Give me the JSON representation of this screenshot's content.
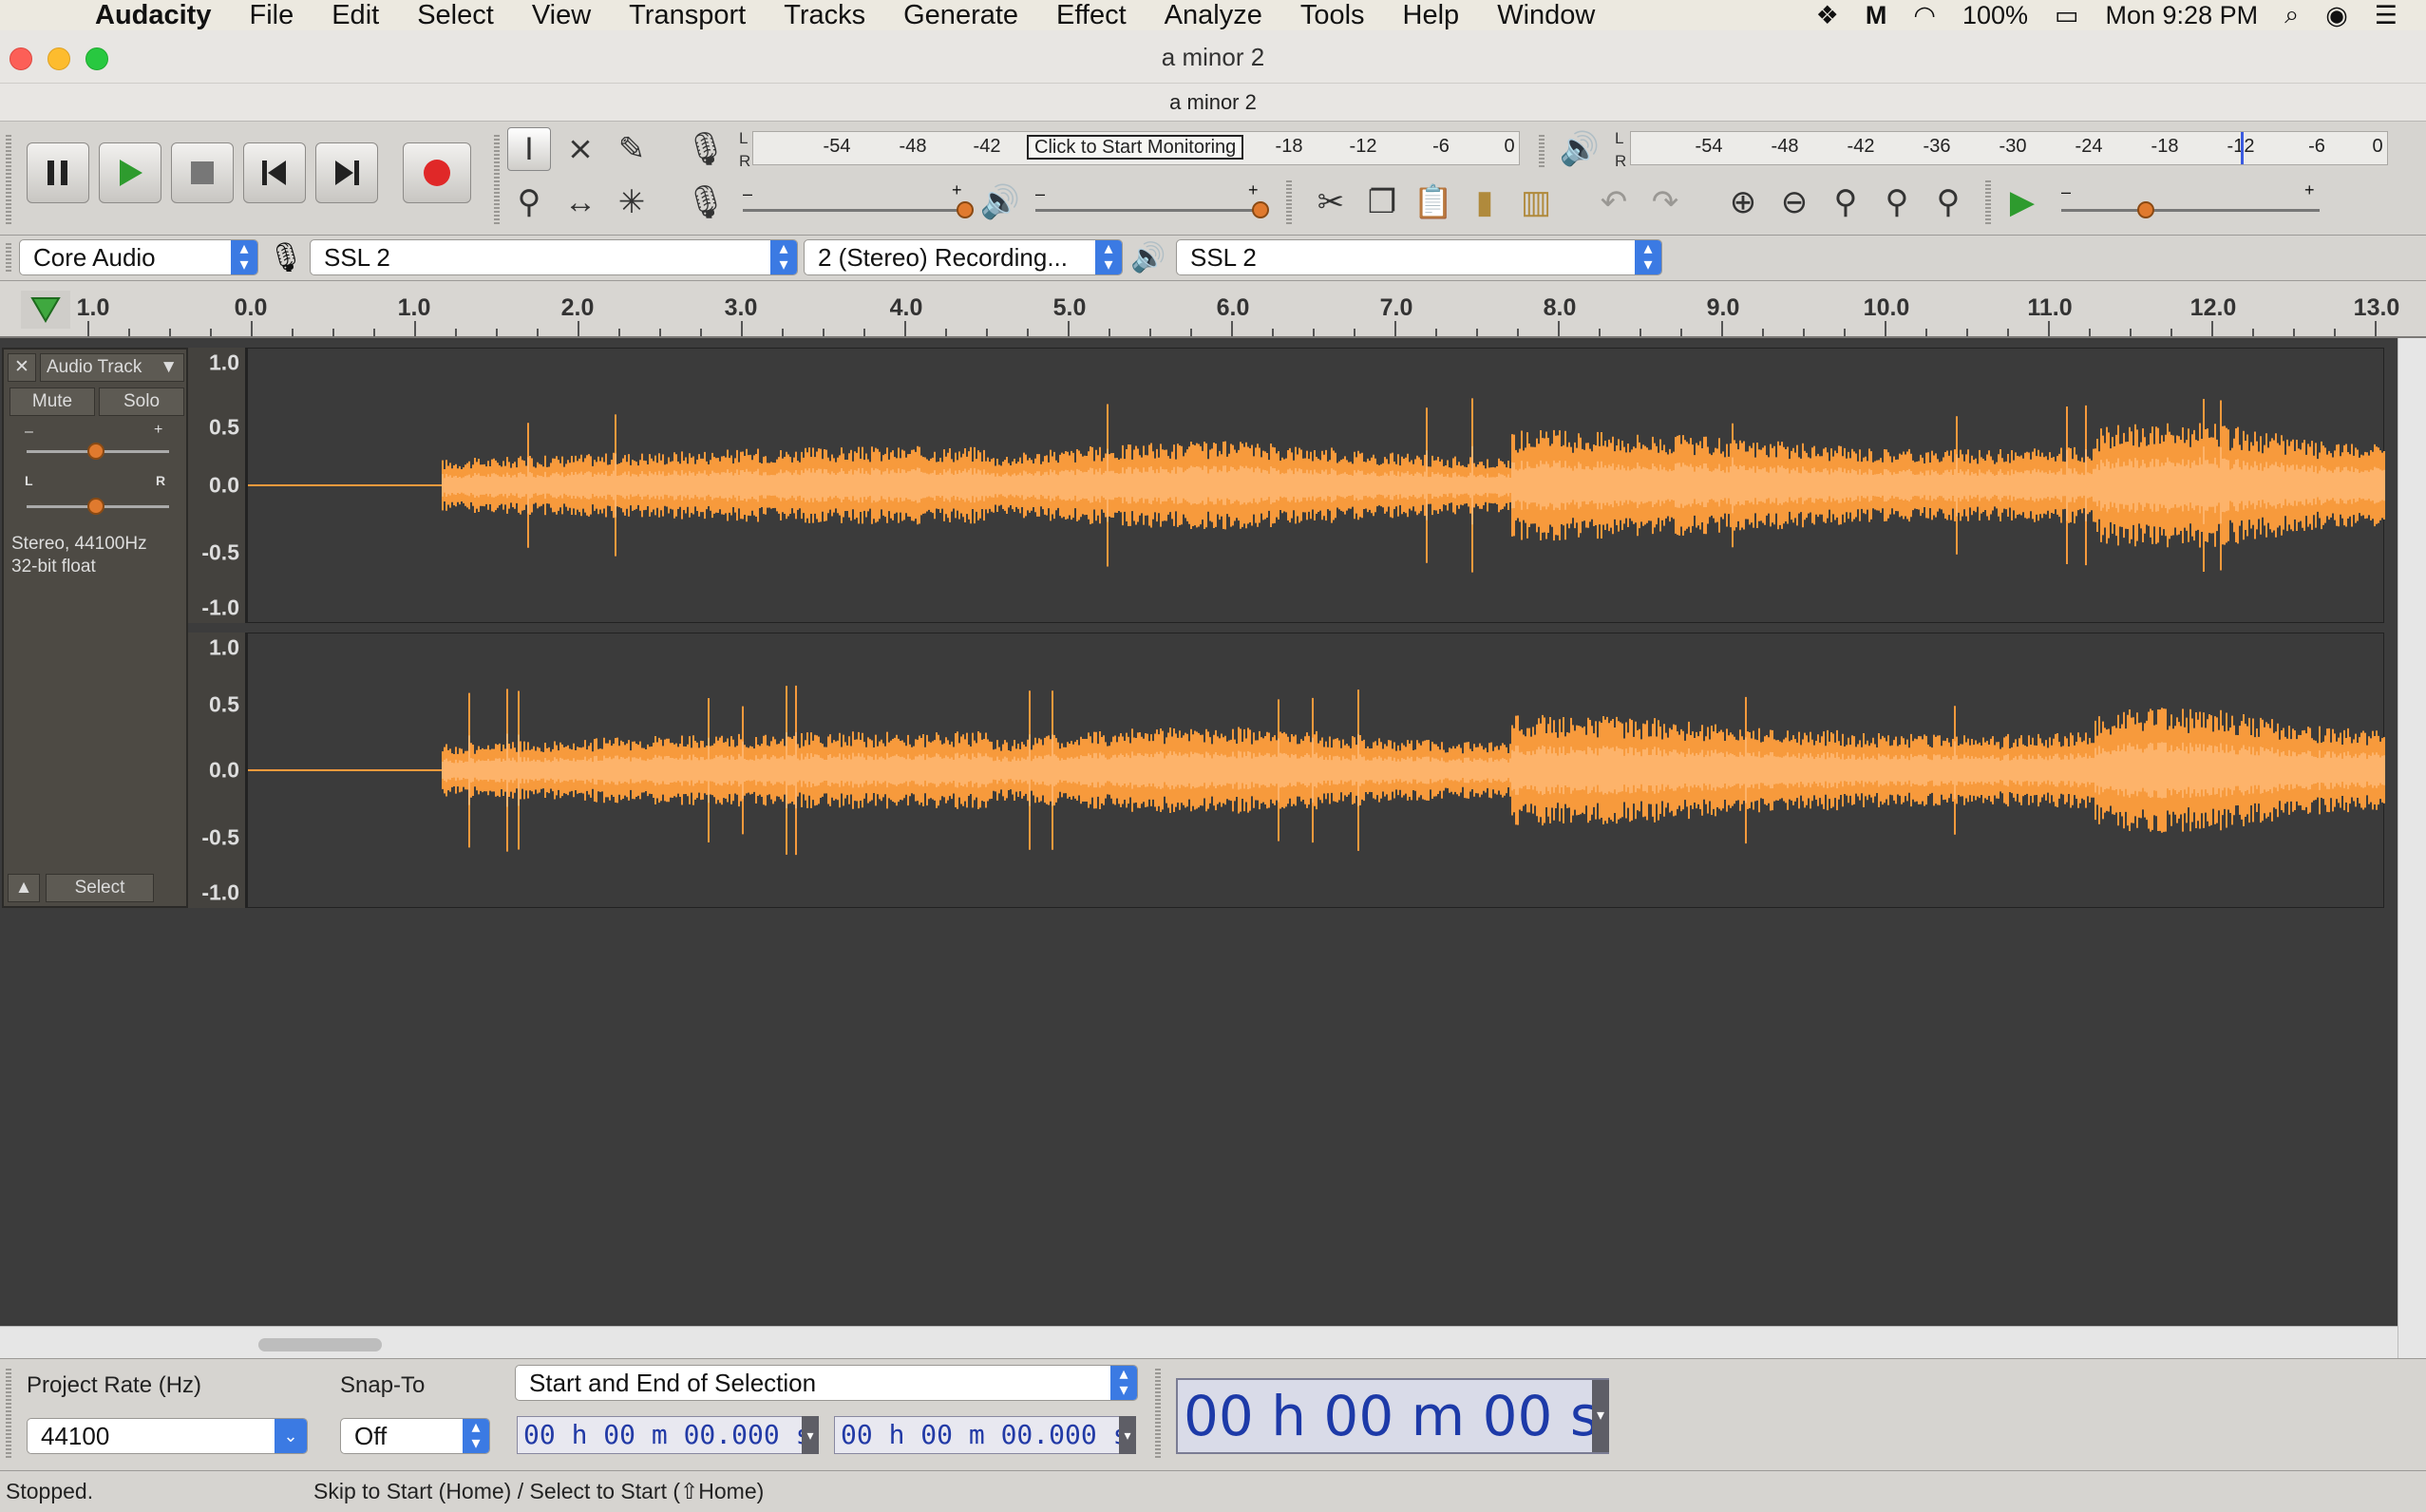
{
  "menubar": {
    "app_name": "Audacity",
    "items": [
      "File",
      "Edit",
      "Select",
      "View",
      "Transport",
      "Tracks",
      "Generate",
      "Effect",
      "Analyze",
      "Tools",
      "Help",
      "Window"
    ],
    "battery": "100%",
    "clock": "Mon 9:28 PM"
  },
  "window": {
    "title": "a minor 2",
    "subtitle": "a minor 2"
  },
  "meters": {
    "record_ticks": [
      "-54",
      "-48",
      "-42",
      "-18",
      "-12",
      "-6",
      "0"
    ],
    "monitor_prompt": "Click to Start Monitoring",
    "playback_ticks": [
      "-54",
      "-48",
      "-42",
      "-36",
      "-30",
      "-24",
      "-18",
      "-12",
      "-6",
      "0"
    ],
    "channel_left": "L",
    "channel_right": "R"
  },
  "devices": {
    "host": "Core Audio",
    "recording_device": "SSL 2",
    "recording_channels": "2 (Stereo) Recording...",
    "playback_device": "SSL 2"
  },
  "ruler": {
    "labels": [
      "1.0",
      "0.0",
      "1.0",
      "2.0",
      "3.0",
      "4.0",
      "5.0",
      "6.0",
      "7.0",
      "8.0",
      "9.0",
      "10.0",
      "11.0",
      "12.0",
      "13.0"
    ]
  },
  "track": {
    "name": "Audio Track",
    "mute_label": "Mute",
    "solo_label": "Solo",
    "gain_minus": "–",
    "gain_plus": "+",
    "pan_left": "L",
    "pan_right": "R",
    "format_line1": "Stereo, 44100Hz",
    "format_line2": "32-bit float",
    "select_label": "Select",
    "amplitude_labels": [
      "1.0",
      "0.5",
      "0.0",
      "-0.5",
      "-1.0"
    ],
    "waveform_color": "#f79a3c"
  },
  "selection_bar": {
    "project_rate_label": "Project Rate (Hz)",
    "project_rate_value": "44100",
    "snap_to_label": "Snap-To",
    "snap_to_value": "Off",
    "selection_mode": "Start and End of Selection",
    "selection_start": "00 h 00 m 00.000 s",
    "selection_end": "00 h 00 m 00.000 s",
    "audio_position": "00 h 00 m 00 s"
  },
  "status": {
    "state": "Stopped.",
    "hint": "Skip to Start (Home) / Select to Start (⇧Home)"
  }
}
